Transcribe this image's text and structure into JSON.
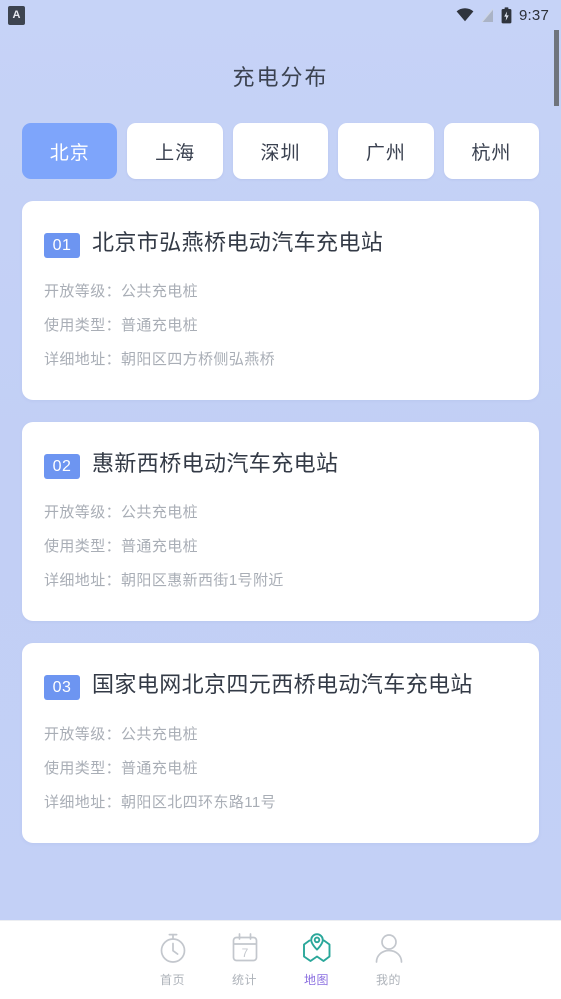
{
  "statusbar": {
    "app_icon_letter": "A",
    "icons": [
      "wifi-icon",
      "signal-icon",
      "battery-icon"
    ],
    "time": "9:37"
  },
  "header": {
    "title": "充电分布"
  },
  "tabs": [
    {
      "label": "北京",
      "active": true
    },
    {
      "label": "上海",
      "active": false
    },
    {
      "label": "深圳",
      "active": false
    },
    {
      "label": "广州",
      "active": false
    },
    {
      "label": "杭州",
      "active": false
    }
  ],
  "labels": {
    "open_level": "开放等级：",
    "use_type": "使用类型：",
    "address": "详细地址："
  },
  "stations": [
    {
      "index": "01",
      "name": "北京市弘燕桥电动汽车充电站",
      "open_level": "公共充电桩",
      "use_type": "普通充电桩",
      "address": "朝阳区四方桥侧弘燕桥"
    },
    {
      "index": "02",
      "name": "惠新西桥电动汽车充电站",
      "open_level": "公共充电桩",
      "use_type": "普通充电桩",
      "address": "朝阳区惠新西街1号附近"
    },
    {
      "index": "03",
      "name": "国家电网北京四元西桥电动汽车充电站",
      "open_level": "公共充电桩",
      "use_type": "普通充电桩",
      "address": "朝阳区北四环东路11号"
    }
  ],
  "bottomnav": [
    {
      "label": "首页",
      "icon": "timer-icon",
      "active": false
    },
    {
      "label": "统计",
      "icon": "calendar-icon",
      "active": false,
      "day": "7"
    },
    {
      "label": "地图",
      "icon": "map-pin-icon",
      "active": true
    },
    {
      "label": "我的",
      "icon": "person-icon",
      "active": false
    }
  ],
  "colors": {
    "background": "#c2d0f6",
    "accent_blue": "#7ea5fb",
    "badge_blue": "#6d95f1",
    "active_nav_icon": "#2aa79a",
    "active_nav_label": "#8b6fe0",
    "card_white": "#ffffff",
    "muted_text": "#a9aeb6"
  }
}
